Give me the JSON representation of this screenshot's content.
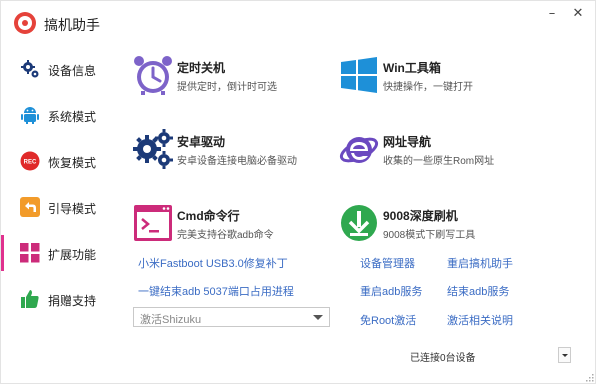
{
  "app": {
    "title": "搞机助手"
  },
  "window": {
    "minimize_icon": "minimize-icon",
    "close_icon": "close-icon"
  },
  "colors": {
    "accent": "#e0318e",
    "link": "#3b6cc4",
    "purple": "#7d63c9",
    "blue": "#1e90d8",
    "green": "#2fa84f",
    "navy": "#1c3a78",
    "pink": "#cc2b7a"
  },
  "sidebar": {
    "items": [
      {
        "label": "设备信息",
        "icon": "gears-icon"
      },
      {
        "label": "系统模式",
        "icon": "android-icon"
      },
      {
        "label": "恢复模式",
        "icon": "rec-icon"
      },
      {
        "label": "引导模式",
        "icon": "back-arrow-icon"
      },
      {
        "label": "扩展功能",
        "icon": "grid-icon",
        "active": true
      },
      {
        "label": "捐赠支持",
        "icon": "thumbs-up-icon"
      }
    ]
  },
  "tiles": [
    {
      "title": "定时关机",
      "desc": "提供定时，倒计时可选",
      "icon": "alarm-clock-icon"
    },
    {
      "title": "Win工具箱",
      "desc": "快捷操作，一键打开",
      "icon": "windows-icon"
    },
    {
      "title": "安卓驱动",
      "desc": "安卓设备连接电脑必备驱动",
      "icon": "gears-icon"
    },
    {
      "title": "网址导航",
      "desc": "收集的一些原生Rom网址",
      "icon": "browser-e-icon"
    },
    {
      "title": "Cmd命令行",
      "desc": "完美支持谷歌adb命令",
      "icon": "terminal-icon"
    },
    {
      "title": "9008深度刷机",
      "desc": "9008模式下刷写工具",
      "icon": "download-icon"
    }
  ],
  "links": {
    "fastboot_patch": "小米Fastboot USB3.0修复补丁",
    "device_manager": "设备管理器",
    "restart_app": "重启搞机助手",
    "kill_adb_port": "一键结束adb 5037端口占用进程",
    "restart_adb": "重启adb服务",
    "stop_adb": "结束adb服务",
    "root_free_activate": "免Root激活",
    "activate_help": "激活相关说明"
  },
  "shizuku_select": {
    "value": "激活Shizuku"
  },
  "status": {
    "connected_devices": "已连接0台设备"
  }
}
